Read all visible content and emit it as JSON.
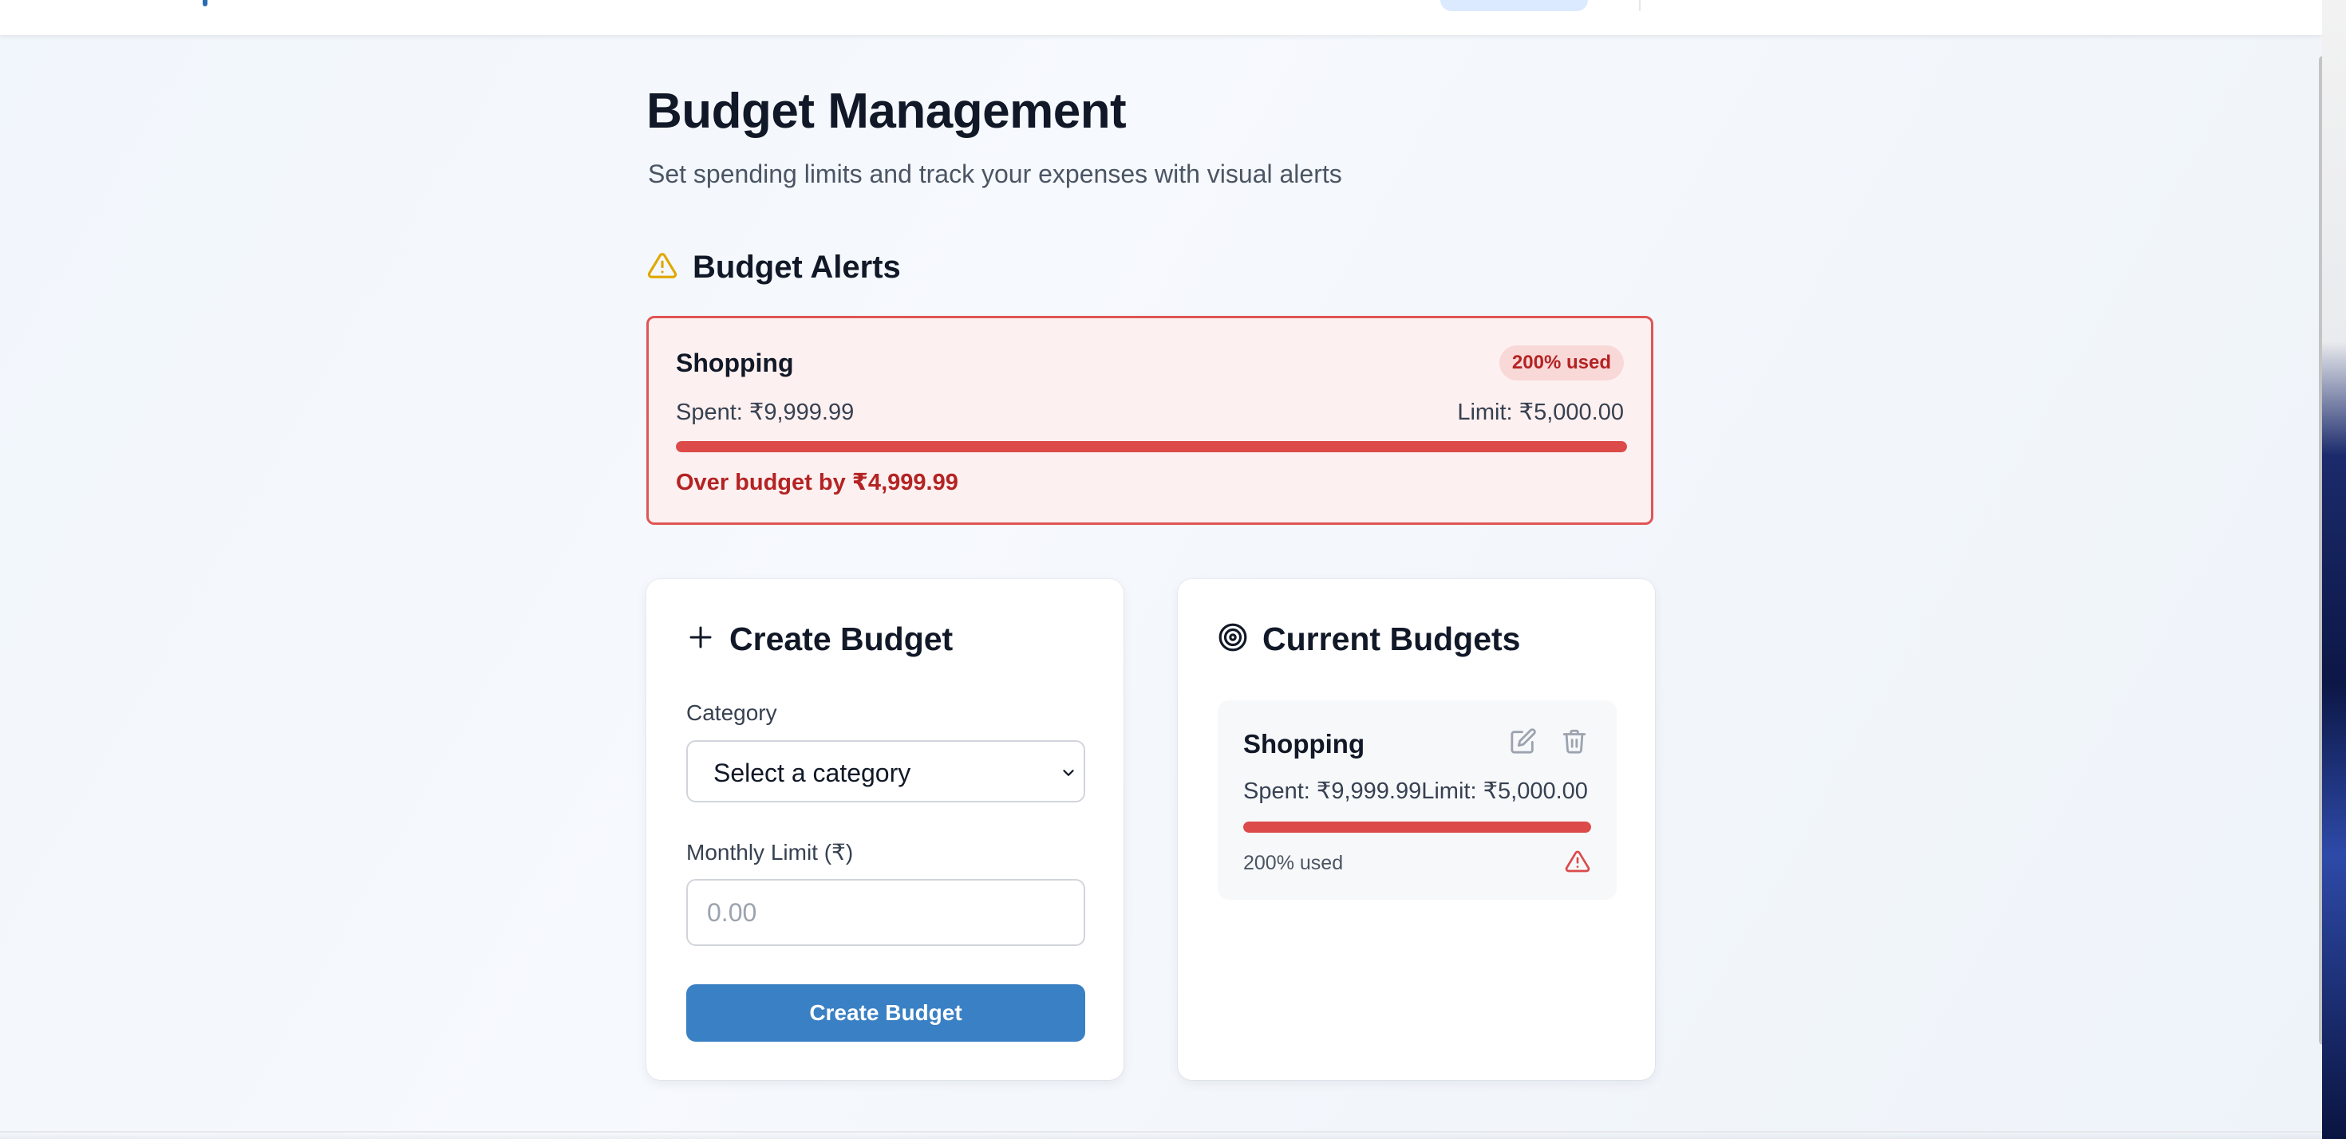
{
  "page": {
    "title": "Budget Management",
    "subtitle": "Set spending limits and track your expenses with visual alerts"
  },
  "alerts": {
    "heading": "Budget Alerts",
    "icon": "warning-triangle-icon",
    "items": [
      {
        "category": "Shopping",
        "badge": "200% used",
        "spent": "Spent: ₹9,999.99",
        "limit": "Limit: ₹5,000.00",
        "progress_percent": 100,
        "over_message": "Over budget by ₹4,999.99"
      }
    ]
  },
  "create": {
    "heading": "Create Budget",
    "icon": "plus-icon",
    "category_label": "Category",
    "category_value": "Select a category",
    "limit_label": "Monthly Limit (₹)",
    "limit_placeholder": "0.00",
    "submit_label": "Create Budget"
  },
  "current": {
    "heading": "Current Budgets",
    "icon": "target-icon",
    "items": [
      {
        "category": "Shopping",
        "amounts": "Spent: ₹9,999.99Limit: ₹5,000.00",
        "progress_percent": 100,
        "usage": "200% used",
        "edit_icon": "edit-icon",
        "delete_icon": "trash-icon",
        "status_icon": "warning-triangle-icon"
      }
    ]
  },
  "colors": {
    "accent": "#3a80c4",
    "danger": "#dc4a4a",
    "warning": "#e0a800",
    "alert_bg": "#fdf0f0"
  }
}
